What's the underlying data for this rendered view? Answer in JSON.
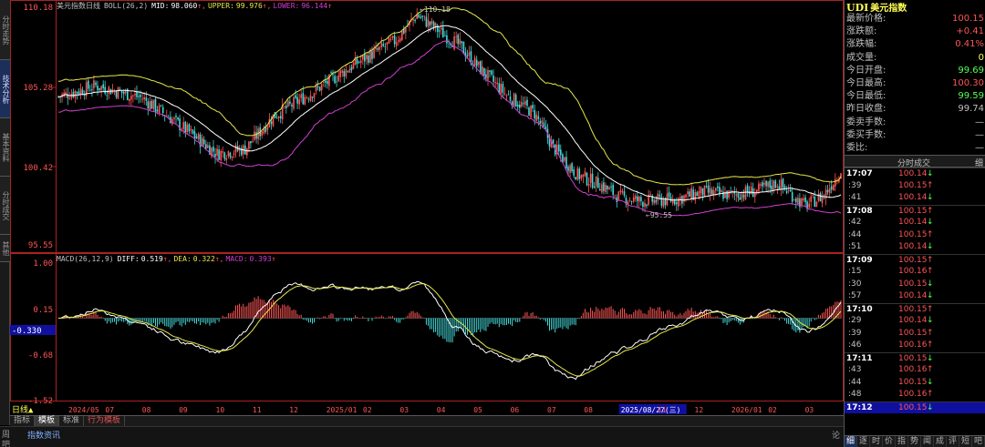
{
  "left_tabs": [
    "分时走势",
    "技术分析",
    "基本资料",
    "分时成交",
    "其他"
  ],
  "main_chart": {
    "header": {
      "symbol": "美元指数",
      "period": "日线",
      "indicator": "BOLL(26,2)",
      "mid_label": "MID:",
      "mid_value": "98.060",
      "upper_label": "UPPER:",
      "upper_value": "99.976",
      "lower_label": "LOWER:",
      "lower_value": "96.144"
    },
    "y_ticks": [
      "110.18",
      "105.28",
      "100.42",
      "95.55"
    ],
    "high_marker": "110.18",
    "low_marker": "95.55",
    "price_range": [
      95.0,
      110.5
    ]
  },
  "macd": {
    "header": {
      "indicator": "MACD(26,12,9)",
      "diff_label": "DIFF:",
      "diff_value": "0.519",
      "dea_label": "DEA:",
      "dea_value": "0.322",
      "macd_label": "MACD:",
      "macd_value": "0.393"
    },
    "y_ticks": [
      "1.00",
      "0.15",
      "-0.68",
      "-1.52"
    ],
    "current_value": "-0.330",
    "range": [
      -1.52,
      1.0
    ]
  },
  "x_axis": {
    "labels": [
      "2024/05",
      "07",
      "08",
      "09",
      "10",
      "11",
      "12",
      "2025/01",
      "02",
      "03",
      "04",
      "05",
      "06",
      "07",
      "08",
      "2025/08/27(三)",
      "11",
      "12",
      "2026/01",
      "02",
      "03"
    ],
    "period_label": "日线"
  },
  "bottom_tabs": [
    "指标",
    "模板",
    "标准",
    "行为模板"
  ],
  "status": {
    "line1": "周",
    "line2": "吧",
    "link": "指数资讯",
    "right": "论"
  },
  "quote": {
    "code": "UDI",
    "name": "美元指数",
    "rows": [
      {
        "label": "最新价格:",
        "value": "100.15",
        "color": "#ff5555"
      },
      {
        "label": "涨跌额:",
        "value": "+0.41",
        "color": "#ff5555"
      },
      {
        "label": "涨跌幅:",
        "value": "0.41%",
        "color": "#ff5555"
      },
      {
        "label": "成交量:",
        "value": "0",
        "color": "#ffff55"
      },
      {
        "label": "今日开盘:",
        "value": "99.69",
        "color": "#55ff55"
      },
      {
        "label": "今日最高:",
        "value": "100.30",
        "color": "#ff5555"
      },
      {
        "label": "今日最低:",
        "value": "99.59",
        "color": "#55ff55"
      },
      {
        "label": "昨日收盘:",
        "value": "99.74",
        "color": "#c0c0c0"
      },
      {
        "label": "委卖手数:",
        "value": "—",
        "color": "#c0c0c0"
      },
      {
        "label": "委买手数:",
        "value": "—",
        "color": "#c0c0c0"
      },
      {
        "label": "委比:",
        "value": "—",
        "color": "#c0c0c0"
      }
    ]
  },
  "ticks_panel": {
    "title": "分时成交",
    "right": "细",
    "rows": [
      {
        "time": "17:07",
        "price": "100.14",
        "dir": "down",
        "minute": true
      },
      {
        "time": ":39",
        "price": "100.15",
        "dir": "up",
        "minute": false
      },
      {
        "time": ":41",
        "price": "100.14",
        "dir": "down",
        "minute": false
      },
      {
        "time": "17:08",
        "price": "100.15",
        "dir": "up",
        "minute": true
      },
      {
        "time": ":42",
        "price": "100.14",
        "dir": "down",
        "minute": false
      },
      {
        "time": ":44",
        "price": "100.15",
        "dir": "up",
        "minute": false
      },
      {
        "time": ":51",
        "price": "100.14",
        "dir": "down",
        "minute": false
      },
      {
        "time": "17:09",
        "price": "100.15",
        "dir": "up",
        "minute": true
      },
      {
        "time": ":15",
        "price": "100.16",
        "dir": "up",
        "minute": false
      },
      {
        "time": ":30",
        "price": "100.15",
        "dir": "down",
        "minute": false
      },
      {
        "time": ":57",
        "price": "100.14",
        "dir": "down",
        "minute": false
      },
      {
        "time": "17:10",
        "price": "100.15",
        "dir": "up",
        "minute": true
      },
      {
        "time": ":29",
        "price": "100.14",
        "dir": "down",
        "minute": false
      },
      {
        "time": ":39",
        "price": "100.15",
        "dir": "up",
        "minute": false
      },
      {
        "time": ":46",
        "price": "100.16",
        "dir": "up",
        "minute": false
      },
      {
        "time": "17:11",
        "price": "100.15",
        "dir": "down",
        "minute": true
      },
      {
        "time": ":43",
        "price": "100.16",
        "dir": "up",
        "minute": false
      },
      {
        "time": ":44",
        "price": "100.15",
        "dir": "down",
        "minute": false
      },
      {
        "time": ":48",
        "price": "100.16",
        "dir": "up",
        "minute": false
      },
      {
        "time": "17:12",
        "price": "100.15",
        "dir": "down",
        "minute": true,
        "selected": true
      }
    ]
  },
  "right_bottom_tabs": [
    "细",
    "逐",
    "时",
    "价",
    "指",
    "势",
    "闻",
    "成",
    "评",
    "短",
    "吧"
  ],
  "colors": {
    "up": "#ff5555",
    "down": "#55ff55",
    "mid": "#ffffff",
    "upper": "#e8e84a",
    "lower": "#d040d0",
    "diff": "#ffffff",
    "dea": "#e8e84a",
    "macd_pos": "#ff5555",
    "macd_neg": "#44d8d8",
    "border": "#aa2222"
  }
}
